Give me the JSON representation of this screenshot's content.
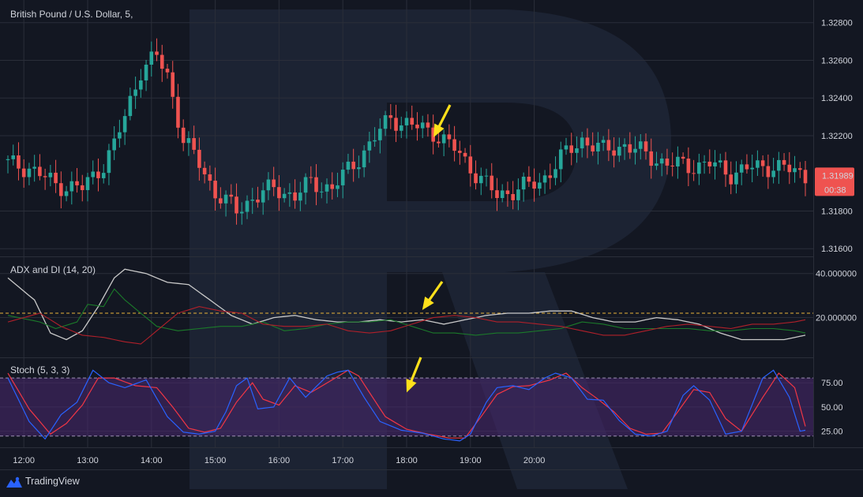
{
  "colors": {
    "background": "#131722",
    "up": "#26a69a",
    "down": "#ef5350",
    "grid": "#2a2e39",
    "axis_text": "#d1d4dc",
    "adx": "#c9c9c9",
    "plus_di": "#1b7a2a",
    "minus_di": "#b0202a",
    "adx_level": "#e8b33a",
    "stoch_k": "#2962ff",
    "stoch_d": "#f23645",
    "stoch_band": "#4a2870",
    "arrow": "#ffe01b"
  },
  "header": {
    "title": "British Pound / U.S. Dollar, 5,"
  },
  "price_panel": {
    "ticks": [
      "1.32800",
      "1.32600",
      "1.32400",
      "1.32200",
      "1.31800",
      "1.31600"
    ],
    "tick_values": [
      1.328,
      1.326,
      1.324,
      1.322,
      1.318,
      1.316
    ],
    "ylim": [
      1.3158,
      1.3287
    ],
    "last_price": "1.31989",
    "countdown": "00:38"
  },
  "adx_panel": {
    "title": "ADX and DI (14, 20)",
    "ticks": [
      "40.000000",
      "20.000000"
    ],
    "tick_values": [
      40,
      20
    ],
    "ylim": [
      3,
      46
    ],
    "level": 22
  },
  "stoch_panel": {
    "title": "Stoch (5, 3, 3)",
    "ticks": [
      "75.00",
      "50.00",
      "25.00"
    ],
    "tick_values": [
      75,
      50,
      25
    ],
    "ylim": [
      10,
      98
    ],
    "upper": 80,
    "lower": 20
  },
  "time_axis": {
    "labels": [
      "12:00",
      "13:00",
      "14:00",
      "15:00",
      "16:00",
      "17:00",
      "18:00",
      "19:00",
      "20:00"
    ],
    "hours": [
      12,
      13,
      14,
      15,
      16,
      17,
      18,
      19,
      20
    ]
  },
  "footer": {
    "brand": "TradingView",
    "logo_icon": "tradingview-logo-icon"
  },
  "chart_data": {
    "type": "candlestick",
    "start_time": "11:45",
    "interval_minutes": 5,
    "close_anchors": [
      [
        0,
        1.3205
      ],
      [
        4,
        1.3203
      ],
      [
        9,
        1.3194
      ],
      [
        14,
        1.3192
      ],
      [
        18,
        1.3205
      ],
      [
        20,
        1.3215
      ],
      [
        22,
        1.323
      ],
      [
        25,
        1.3255
      ],
      [
        28,
        1.3262
      ],
      [
        30,
        1.3252
      ],
      [
        33,
        1.3218
      ],
      [
        36,
        1.3205
      ],
      [
        39,
        1.319
      ],
      [
        43,
        1.318
      ],
      [
        46,
        1.3187
      ],
      [
        50,
        1.3192
      ],
      [
        54,
        1.3188
      ],
      [
        57,
        1.3195
      ],
      [
        61,
        1.3192
      ],
      [
        65,
        1.3205
      ],
      [
        68,
        1.3215
      ],
      [
        72,
        1.323
      ],
      [
        74,
        1.3227
      ],
      [
        80,
        1.3222
      ],
      [
        84,
        1.3213
      ],
      [
        88,
        1.32
      ],
      [
        92,
        1.3188
      ],
      [
        96,
        1.3192
      ],
      [
        100,
        1.3195
      ],
      [
        104,
        1.3208
      ],
      [
        108,
        1.3218
      ],
      [
        112,
        1.3212
      ],
      [
        116,
        1.3215
      ],
      [
        120,
        1.321
      ],
      [
        124,
        1.3205
      ],
      [
        128,
        1.3204
      ],
      [
        132,
        1.3205
      ],
      [
        136,
        1.32
      ],
      [
        140,
        1.3203
      ],
      [
        144,
        1.3204
      ],
      [
        148,
        1.3201
      ],
      [
        150,
        1.3199
      ]
    ],
    "adx": [
      [
        0,
        38
      ],
      [
        5,
        28
      ],
      [
        8,
        13
      ],
      [
        11,
        10
      ],
      [
        14,
        14
      ],
      [
        17,
        25
      ],
      [
        20,
        38
      ],
      [
        22,
        42
      ],
      [
        26,
        40
      ],
      [
        30,
        36
      ],
      [
        34,
        35
      ],
      [
        38,
        28
      ],
      [
        42,
        21
      ],
      [
        46,
        17
      ],
      [
        50,
        20
      ],
      [
        54,
        21
      ],
      [
        58,
        19
      ],
      [
        62,
        18
      ],
      [
        66,
        18
      ],
      [
        70,
        19
      ],
      [
        74,
        18
      ],
      [
        78,
        19
      ],
      [
        82,
        17
      ],
      [
        86,
        19
      ],
      [
        90,
        21
      ],
      [
        94,
        22
      ],
      [
        98,
        22
      ],
      [
        102,
        23
      ],
      [
        106,
        23
      ],
      [
        110,
        20
      ],
      [
        114,
        18
      ],
      [
        118,
        18
      ],
      [
        122,
        20
      ],
      [
        126,
        19
      ],
      [
        130,
        17
      ],
      [
        134,
        13
      ],
      [
        138,
        10
      ],
      [
        142,
        10
      ],
      [
        146,
        10
      ],
      [
        150,
        12
      ]
    ],
    "plus_di": [
      [
        0,
        21
      ],
      [
        6,
        18
      ],
      [
        9,
        15
      ],
      [
        13,
        18
      ],
      [
        15,
        26
      ],
      [
        18,
        25
      ],
      [
        20,
        33
      ],
      [
        22,
        28
      ],
      [
        25,
        22
      ],
      [
        28,
        16
      ],
      [
        32,
        14
      ],
      [
        36,
        15
      ],
      [
        40,
        16
      ],
      [
        44,
        16
      ],
      [
        48,
        18
      ],
      [
        52,
        14
      ],
      [
        56,
        15
      ],
      [
        60,
        17
      ],
      [
        64,
        18
      ],
      [
        68,
        18
      ],
      [
        72,
        19
      ],
      [
        76,
        16
      ],
      [
        80,
        13
      ],
      [
        84,
        13
      ],
      [
        88,
        12
      ],
      [
        92,
        13
      ],
      [
        96,
        13
      ],
      [
        100,
        14
      ],
      [
        104,
        15
      ],
      [
        108,
        18
      ],
      [
        112,
        17
      ],
      [
        116,
        15
      ],
      [
        120,
        15
      ],
      [
        124,
        15
      ],
      [
        128,
        15
      ],
      [
        132,
        14
      ],
      [
        136,
        14
      ],
      [
        140,
        15
      ],
      [
        144,
        15
      ],
      [
        148,
        14
      ],
      [
        150,
        13
      ]
    ],
    "minus_di": [
      [
        0,
        18
      ],
      [
        6,
        22
      ],
      [
        10,
        16
      ],
      [
        14,
        12
      ],
      [
        18,
        11
      ],
      [
        22,
        9
      ],
      [
        25,
        8
      ],
      [
        28,
        14
      ],
      [
        32,
        22
      ],
      [
        36,
        25
      ],
      [
        40,
        23
      ],
      [
        44,
        22
      ],
      [
        48,
        17
      ],
      [
        52,
        16
      ],
      [
        56,
        16
      ],
      [
        60,
        17
      ],
      [
        64,
        14
      ],
      [
        68,
        13
      ],
      [
        72,
        14
      ],
      [
        76,
        17
      ],
      [
        80,
        20
      ],
      [
        84,
        21
      ],
      [
        88,
        20
      ],
      [
        92,
        18
      ],
      [
        96,
        18
      ],
      [
        100,
        17
      ],
      [
        104,
        16
      ],
      [
        108,
        14
      ],
      [
        112,
        12
      ],
      [
        116,
        12
      ],
      [
        120,
        14
      ],
      [
        124,
        16
      ],
      [
        128,
        17
      ],
      [
        132,
        16
      ],
      [
        136,
        15
      ],
      [
        140,
        17
      ],
      [
        144,
        17
      ],
      [
        148,
        18
      ],
      [
        150,
        19
      ]
    ],
    "stoch_k": [
      [
        0,
        80
      ],
      [
        4,
        35
      ],
      [
        7,
        17
      ],
      [
        10,
        42
      ],
      [
        13,
        55
      ],
      [
        16,
        88
      ],
      [
        19,
        75
      ],
      [
        22,
        70
      ],
      [
        26,
        78
      ],
      [
        30,
        40
      ],
      [
        33,
        24
      ],
      [
        36,
        22
      ],
      [
        39,
        25
      ],
      [
        41,
        45
      ],
      [
        43,
        72
      ],
      [
        45,
        80
      ],
      [
        47,
        48
      ],
      [
        50,
        50
      ],
      [
        53,
        80
      ],
      [
        56,
        60
      ],
      [
        60,
        82
      ],
      [
        62,
        86
      ],
      [
        64,
        88
      ],
      [
        67,
        60
      ],
      [
        70,
        35
      ],
      [
        74,
        26
      ],
      [
        78,
        23
      ],
      [
        82,
        17
      ],
      [
        85,
        15
      ],
      [
        87,
        22
      ],
      [
        90,
        55
      ],
      [
        92,
        70
      ],
      [
        95,
        72
      ],
      [
        98,
        68
      ],
      [
        101,
        80
      ],
      [
        103,
        85
      ],
      [
        106,
        80
      ],
      [
        109,
        58
      ],
      [
        112,
        57
      ],
      [
        115,
        36
      ],
      [
        118,
        22
      ],
      [
        121,
        20
      ],
      [
        124,
        25
      ],
      [
        127,
        62
      ],
      [
        129,
        72
      ],
      [
        132,
        57
      ],
      [
        135,
        22
      ],
      [
        138,
        25
      ],
      [
        142,
        80
      ],
      [
        144,
        88
      ],
      [
        147,
        60
      ],
      [
        149,
        25
      ],
      [
        150,
        26
      ]
    ],
    "stoch_d": [
      [
        0,
        85
      ],
      [
        4,
        48
      ],
      [
        8,
        22
      ],
      [
        11,
        33
      ],
      [
        14,
        52
      ],
      [
        17,
        80
      ],
      [
        20,
        80
      ],
      [
        24,
        72
      ],
      [
        28,
        70
      ],
      [
        31,
        50
      ],
      [
        34,
        28
      ],
      [
        37,
        24
      ],
      [
        40,
        28
      ],
      [
        43,
        55
      ],
      [
        46,
        75
      ],
      [
        48,
        58
      ],
      [
        51,
        52
      ],
      [
        54,
        72
      ],
      [
        57,
        65
      ],
      [
        61,
        78
      ],
      [
        64,
        88
      ],
      [
        66,
        82
      ],
      [
        68,
        65
      ],
      [
        71,
        40
      ],
      [
        75,
        27
      ],
      [
        79,
        22
      ],
      [
        83,
        18
      ],
      [
        86,
        18
      ],
      [
        89,
        40
      ],
      [
        92,
        63
      ],
      [
        95,
        71
      ],
      [
        98,
        72
      ],
      [
        102,
        78
      ],
      [
        105,
        85
      ],
      [
        108,
        70
      ],
      [
        111,
        58
      ],
      [
        114,
        45
      ],
      [
        117,
        28
      ],
      [
        120,
        22
      ],
      [
        123,
        23
      ],
      [
        126,
        45
      ],
      [
        129,
        68
      ],
      [
        132,
        65
      ],
      [
        135,
        38
      ],
      [
        138,
        25
      ],
      [
        142,
        60
      ],
      [
        145,
        85
      ],
      [
        148,
        70
      ],
      [
        150,
        30
      ]
    ]
  }
}
